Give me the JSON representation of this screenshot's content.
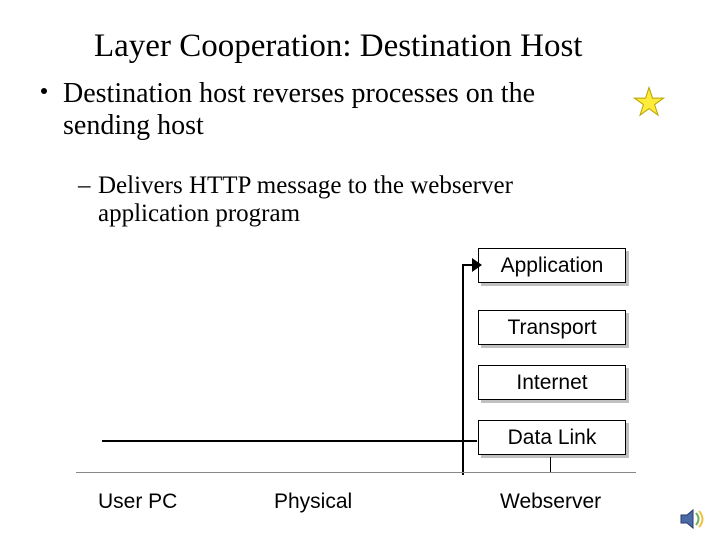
{
  "title": "Layer Cooperation: Destination Host",
  "bullets": {
    "l1a": "Destination host reverses processes on the",
    "l1b": "sending host",
    "l2a": "Delivers HTTP message to the webserver",
    "l2b": "application program"
  },
  "boxes": {
    "application": "Application",
    "transport": "Transport",
    "internet": "Internet",
    "datalink": "Data Link"
  },
  "labels": {
    "user": "User PC",
    "physical": "Physical",
    "webserver": "Webserver"
  }
}
